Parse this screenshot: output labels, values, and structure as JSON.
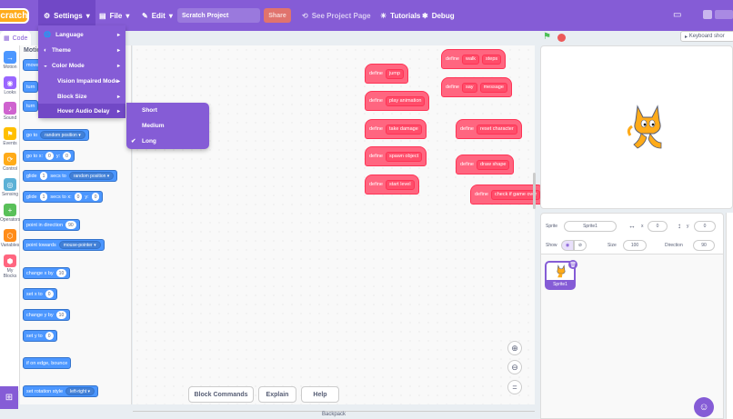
{
  "topbar": {
    "logo": "Scratch",
    "settings_label": "Settings",
    "file_label": "File",
    "edit_label": "Edit",
    "project_title": "Scratch Project",
    "share_label": "Share",
    "see_project_label": "See Project Page",
    "tutorials_label": "Tutorials",
    "debug_label": "Debug",
    "brand_color": "#855cd6"
  },
  "settings_menu": {
    "items": [
      {
        "label": "Language",
        "icon": "globe-icon"
      },
      {
        "label": "Theme",
        "icon": "palette-icon"
      },
      {
        "label": "Color Mode",
        "icon": "color-mode-icon"
      },
      {
        "label": "Vision Impaired Mode"
      },
      {
        "label": "Block Size"
      },
      {
        "label": "Hover Audio Delay"
      }
    ]
  },
  "delay_menu": {
    "items": [
      "Short",
      "Medium",
      "Long"
    ],
    "selected": "Long"
  },
  "tabs": {
    "code": "Code"
  },
  "keyboard_shortcuts": "Keyboard shor",
  "categories": [
    {
      "label": "Motion",
      "color": "#4c97ff",
      "glyph": "→"
    },
    {
      "label": "Looks",
      "color": "#9966ff",
      "glyph": "◉"
    },
    {
      "label": "Sound",
      "color": "#cf63cf",
      "glyph": "♪"
    },
    {
      "label": "Events",
      "color": "#ffbf00",
      "glyph": "⚑"
    },
    {
      "label": "Control",
      "color": "#ffab19",
      "glyph": "⟳"
    },
    {
      "label": "Sensing",
      "color": "#5cb1d6",
      "glyph": "◎"
    },
    {
      "label": "Operators",
      "color": "#59c059",
      "glyph": "+"
    },
    {
      "label": "Variables",
      "color": "#ff8c1a",
      "glyph": "⬡"
    },
    {
      "label": "My Blocks",
      "color": "#ff6680",
      "glyph": "⬢"
    }
  ],
  "palette": {
    "heading": "Motio",
    "blocks": {
      "move": "move",
      "turn1": "turn",
      "turn2": "turn",
      "goto": "go to",
      "goto_opt": "random position",
      "gotoxy": "go to x:",
      "gotoxy_x": "0",
      "gotoxy_y_label": "y:",
      "gotoxy_y": "0",
      "glide1": "glide",
      "glide1_n": "1",
      "glide1_secs": "secs to",
      "glide1_opt": "random position",
      "glide2": "glide",
      "glide2_n": "1",
      "glide2_secs": "secs to x:",
      "glide2_x": "0",
      "glide2_y_label": "y:",
      "glide2_y": "0",
      "point_dir": "point in direction",
      "point_dir_val": "90",
      "point_towards": "point towards",
      "point_towards_opt": "mouse-pointer",
      "change_x": "change x by",
      "change_x_val": "10",
      "set_x": "set x to",
      "set_x_val": "0",
      "change_y": "change y by",
      "change_y_val": "10",
      "set_y": "set y to",
      "set_y_val": "0",
      "bounce": "if on edge, bounce",
      "rot_style": "set rotation style",
      "rot_style_opt": "left-right"
    }
  },
  "scripts": {
    "define_word": "define",
    "blocks": [
      "jump",
      "play animation",
      "take damage",
      "spawn object",
      "start level",
      "walk",
      "steps",
      "say",
      "message",
      "reset character",
      "draw shape",
      "check if game over"
    ]
  },
  "bottom_buttons": {
    "block_commands": "Block Commands",
    "explain": "Explain",
    "help": "Help"
  },
  "backpack_label": "Backpack",
  "sprite_info": {
    "sprite_label": "Sprite",
    "sprite_name": "Sprite1",
    "x_label": "x",
    "x_val": "0",
    "y_label": "y",
    "y_val": "0",
    "show_label": "Show",
    "size_label": "Size",
    "size_val": "100",
    "direction_label": "Direction",
    "direction_val": "90"
  },
  "sprite_tile": {
    "name": "Sprite1"
  }
}
